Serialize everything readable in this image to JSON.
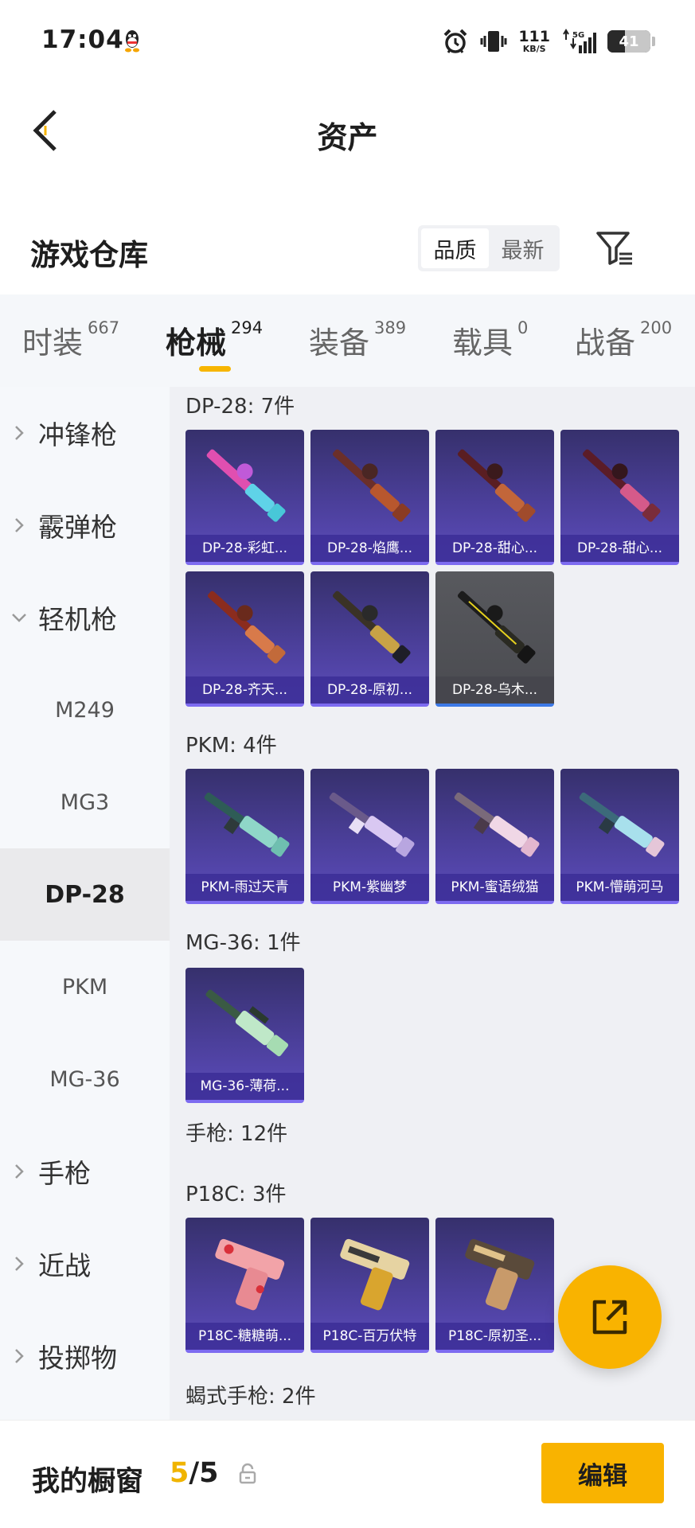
{
  "status_bar": {
    "time": "17:04",
    "net_speed_value": "111",
    "net_speed_unit": "KB/S",
    "network": "5G",
    "battery": "41",
    "icons": [
      "qq-icon",
      "alarm-icon",
      "vibrate-icon",
      "data-arrows-icon",
      "signal-icon",
      "battery-icon"
    ]
  },
  "nav": {
    "title": "资产",
    "back_icon": "chevron-left-icon"
  },
  "warehouse": {
    "title": "游戏仓库",
    "sort_options": [
      "品质",
      "最新"
    ],
    "selected_sort": "品质",
    "filter_icon": "filter-icon"
  },
  "tabs": [
    {
      "label": "时装",
      "count": "667"
    },
    {
      "label": "枪械",
      "count": "294"
    },
    {
      "label": "装备",
      "count": "389"
    },
    {
      "label": "载具",
      "count": "0"
    },
    {
      "label": "战备",
      "count": "200"
    }
  ],
  "active_tab": "枪械",
  "sidebar": [
    {
      "label": "冲锋枪",
      "type": "category",
      "expanded": false
    },
    {
      "label": "霰弹枪",
      "type": "category",
      "expanded": false
    },
    {
      "label": "轻机枪",
      "type": "category",
      "expanded": true
    },
    {
      "label": "M249",
      "type": "sub"
    },
    {
      "label": "MG3",
      "type": "sub"
    },
    {
      "label": "DP-28",
      "type": "sub",
      "active": true
    },
    {
      "label": "PKM",
      "type": "sub"
    },
    {
      "label": "MG-36",
      "type": "sub"
    },
    {
      "label": "手枪",
      "type": "category",
      "expanded": false
    },
    {
      "label": "近战",
      "type": "category",
      "expanded": false
    },
    {
      "label": "投掷物",
      "type": "category",
      "expanded": false
    }
  ],
  "groups": [
    {
      "label": "DP-28: 7件",
      "items": [
        "DP-28-彩虹...",
        "DP-28-焰鹰...",
        "DP-28-甜心...",
        "DP-28-甜心...",
        "DP-28-齐天...",
        "DP-28-原初...",
        "DP-28-乌木..."
      ]
    },
    {
      "label": "PKM: 4件",
      "items": [
        "PKM-雨过天青",
        "PKM-紫幽梦",
        "PKM-蜜语绒猫",
        "PKM-懵萌河马"
      ]
    },
    {
      "label": "MG-36: 1件",
      "items": [
        "MG-36-薄荷..."
      ]
    },
    {
      "label": "手枪: 12件",
      "items": []
    },
    {
      "label": "P18C: 3件",
      "items": [
        "P18C-糖糖萌...",
        "P18C-百万伏特",
        "P18C-原初圣..."
      ]
    },
    {
      "label": "蝎式手枪: 2件",
      "items": []
    }
  ],
  "share_icon": "share-external-icon",
  "bottom": {
    "showcase_label": "我的橱窗",
    "showcase_current": "5",
    "showcase_sep": "/",
    "showcase_total": "5",
    "lock_icon": "lock-icon",
    "edit_label": "编辑"
  }
}
